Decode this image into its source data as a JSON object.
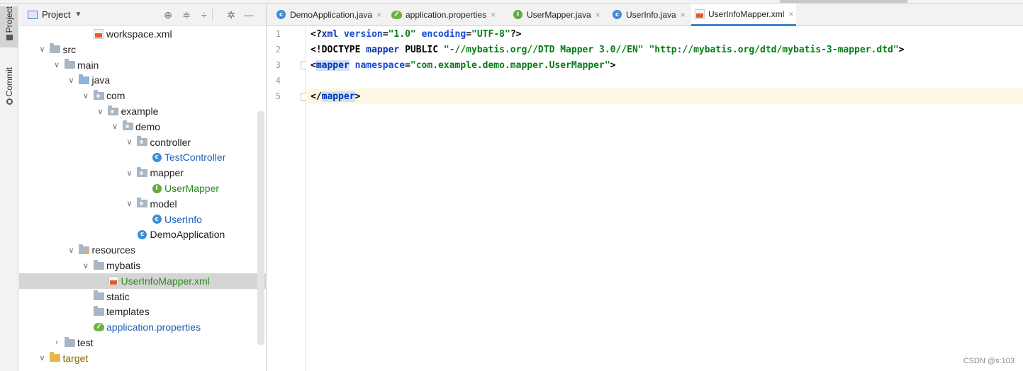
{
  "sidebar_strip": {
    "tabs": [
      {
        "label": "Project",
        "active": true
      },
      {
        "label": "Commit",
        "active": false
      }
    ]
  },
  "project_panel": {
    "title": "Project",
    "buttons": [
      "locate-icon",
      "expand-all-icon",
      "collapse-all-icon",
      "gear-icon",
      "minimize-icon"
    ]
  },
  "tree": [
    {
      "label": "workspace.xml",
      "depth": 4,
      "icon": "xml-file-icon",
      "chevron": "",
      "style": "normal"
    },
    {
      "label": "src",
      "depth": 1,
      "icon": "folder-icon",
      "chevron": "down",
      "style": "normal"
    },
    {
      "label": "main",
      "depth": 2,
      "icon": "folder-icon",
      "chevron": "down",
      "style": "normal"
    },
    {
      "label": "java",
      "depth": 3,
      "icon": "source-folder-icon",
      "chevron": "down",
      "style": "normal"
    },
    {
      "label": "com",
      "depth": 4,
      "icon": "package-icon",
      "chevron": "down",
      "style": "normal"
    },
    {
      "label": "example",
      "depth": 5,
      "icon": "package-icon",
      "chevron": "down",
      "style": "normal"
    },
    {
      "label": "demo",
      "depth": 6,
      "icon": "package-icon",
      "chevron": "down",
      "style": "normal"
    },
    {
      "label": "controller",
      "depth": 7,
      "icon": "package-icon",
      "chevron": "down",
      "style": "normal"
    },
    {
      "label": "TestController",
      "depth": 8,
      "icon": "class-icon",
      "chevron": "",
      "style": "blue"
    },
    {
      "label": "mapper",
      "depth": 7,
      "icon": "package-icon",
      "chevron": "down",
      "style": "normal"
    },
    {
      "label": "UserMapper",
      "depth": 8,
      "icon": "interface-icon",
      "chevron": "",
      "style": "green"
    },
    {
      "label": "model",
      "depth": 7,
      "icon": "package-icon",
      "chevron": "down",
      "style": "normal"
    },
    {
      "label": "UserInfo",
      "depth": 8,
      "icon": "class-icon",
      "chevron": "",
      "style": "blue"
    },
    {
      "label": "DemoApplication",
      "depth": 7,
      "icon": "spring-class-icon",
      "chevron": "",
      "style": "normal"
    },
    {
      "label": "resources",
      "depth": 3,
      "icon": "resources-folder-icon",
      "chevron": "down",
      "style": "normal"
    },
    {
      "label": "mybatis",
      "depth": 4,
      "icon": "folder-icon",
      "chevron": "down",
      "style": "normal"
    },
    {
      "label": "UserInfoMapper.xml",
      "depth": 5,
      "icon": "xml-file-icon",
      "chevron": "",
      "style": "green",
      "selected": true
    },
    {
      "label": "static",
      "depth": 4,
      "icon": "folder-icon",
      "chevron": "",
      "style": "normal"
    },
    {
      "label": "templates",
      "depth": 4,
      "icon": "folder-icon",
      "chevron": "",
      "style": "normal"
    },
    {
      "label": "application.properties",
      "depth": 4,
      "icon": "spring-properties-icon",
      "chevron": "",
      "style": "blue"
    },
    {
      "label": "test",
      "depth": 2,
      "icon": "folder-icon",
      "chevron": "right",
      "style": "normal"
    },
    {
      "label": "target",
      "depth": 1,
      "icon": "excluded-folder-icon",
      "chevron": "down",
      "style": "target"
    }
  ],
  "tabs": [
    {
      "label": "DemoApplication.java",
      "icon": "spring-class-icon",
      "active": false
    },
    {
      "label": "application.properties",
      "icon": "spring-properties-icon",
      "active": false
    },
    {
      "label": "UserMapper.java",
      "icon": "interface-icon",
      "active": false
    },
    {
      "label": "UserInfo.java",
      "icon": "class-icon",
      "active": false
    },
    {
      "label": "UserInfoMapper.xml",
      "icon": "xml-file-icon",
      "active": true
    }
  ],
  "editor": {
    "line_numbers": [
      "1",
      "2",
      "3",
      "4",
      "5"
    ],
    "lines": [
      [
        {
          "t": "<?",
          "c": "plain"
        },
        {
          "t": "xml ",
          "c": "name"
        },
        {
          "t": "version",
          "c": "attr"
        },
        {
          "t": "=",
          "c": "plain"
        },
        {
          "t": "\"1.0\"",
          "c": "str"
        },
        {
          "t": " ",
          "c": "plain"
        },
        {
          "t": "encoding",
          "c": "attr"
        },
        {
          "t": "=",
          "c": "plain"
        },
        {
          "t": "\"UTF-8\"",
          "c": "str"
        },
        {
          "t": "?>",
          "c": "plain"
        }
      ],
      [
        {
          "t": "<!DOCTYPE ",
          "c": "plain"
        },
        {
          "t": "mapper",
          "c": "name"
        },
        {
          "t": " PUBLIC ",
          "c": "plain"
        },
        {
          "t": "\"-//mybatis.org//DTD Mapper 3.0//EN\"",
          "c": "str"
        },
        {
          "t": " ",
          "c": "plain"
        },
        {
          "t": "\"http://mybatis.org/dtd/mybatis-3-mapper.dtd\"",
          "c": "str"
        },
        {
          "t": ">",
          "c": "plain"
        }
      ],
      [
        {
          "t": "<",
          "c": "plain"
        },
        {
          "t": "mapper",
          "c": "hltag"
        },
        {
          "t": " ",
          "c": "plain"
        },
        {
          "t": "namespace",
          "c": "attr"
        },
        {
          "t": "=",
          "c": "plain"
        },
        {
          "t": "\"com.example.demo.mapper.UserMapper\"",
          "c": "str"
        },
        {
          "t": ">",
          "c": "plain"
        }
      ],
      [],
      [
        {
          "t": "</",
          "c": "plain"
        },
        {
          "t": "mapper",
          "c": "hltag"
        },
        {
          "t": ">",
          "c": "plain"
        }
      ]
    ],
    "current_line": 5
  },
  "watermark": "CSDN @s:103",
  "colors": {
    "accent": "#4083c9",
    "selection": "#d5d5d5",
    "current_line": "#fcf8e1",
    "string": "#067d17",
    "keyword": "#0033b3"
  }
}
